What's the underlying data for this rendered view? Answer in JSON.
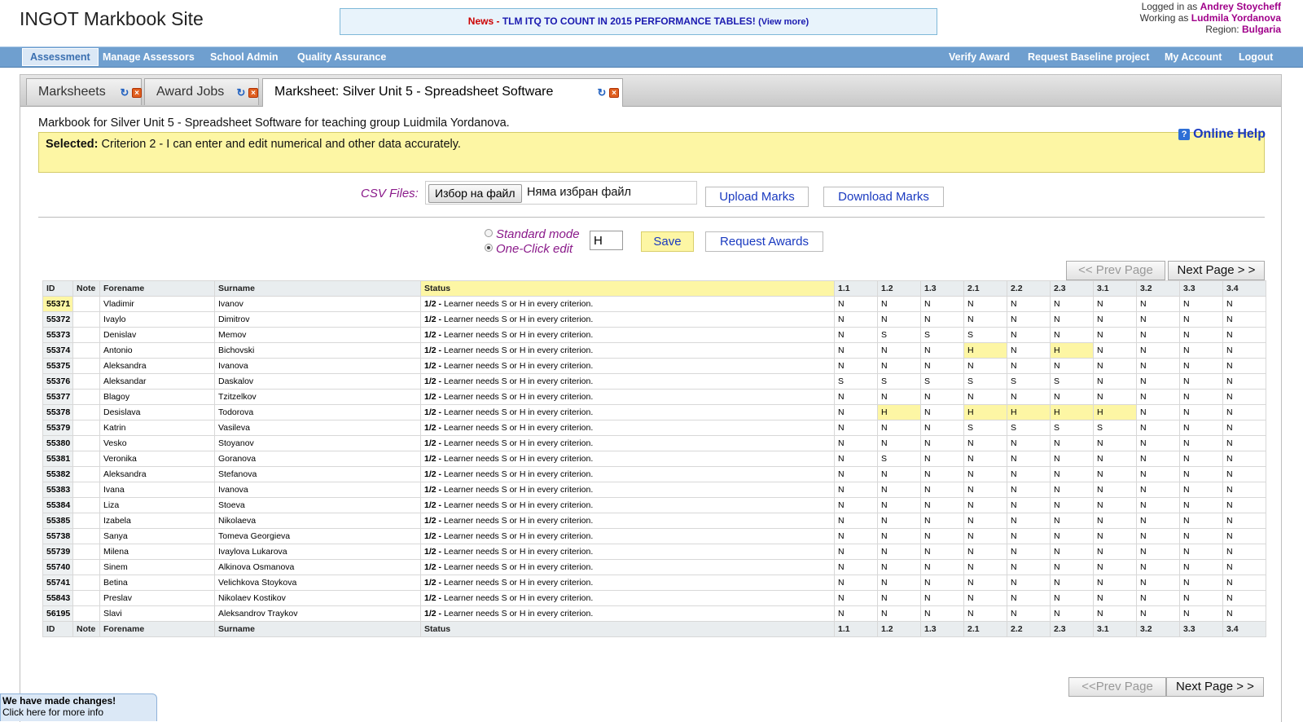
{
  "header": {
    "site_title": "INGOT Markbook Site",
    "news_label": "News",
    "news_text": "TLM ITQ TO COUNT IN 2015 PERFORMANCE TABLES!",
    "news_more": "(View more)",
    "logged_prefix": "Logged in as",
    "logged_user": "Andrey Stoycheff",
    "working_prefix": "Working as",
    "working_user": "Ludmila Yordanova",
    "region_prefix": "Region:",
    "region": "Bulgaria"
  },
  "nav": {
    "left": [
      "Assessment",
      "Manage Assessors",
      "School Admin",
      "Quality Assurance"
    ],
    "right": [
      "Verify Award",
      "Request Baseline project",
      "My Account",
      "Logout"
    ]
  },
  "tabs": [
    "Marksheets",
    "Award Jobs",
    "Marksheet: Silver Unit 5 - Spreadsheet Software"
  ],
  "markbook": {
    "description": "Markbook for Silver Unit 5 - Spreadsheet Software for teaching group Luidmila Yordanova.",
    "online_help": "Online Help",
    "selected_label": "Selected:",
    "selected_text": "Criterion 2 - I can enter and edit numerical and other data accurately."
  },
  "csv": {
    "label": "CSV Files:",
    "choose_file": "Избор на файл",
    "no_file": "Няма избран файл",
    "upload": "Upload Marks",
    "download": "Download Marks"
  },
  "modes": {
    "standard": "Standard mode",
    "one_click": "One-Click edit",
    "mark_value": "H",
    "save": "Save",
    "request_awards": "Request Awards"
  },
  "pager": {
    "prev_top": "<< Prev Page",
    "next_top": "Next Page > >",
    "prev_bottom": "<<Prev Page",
    "next_bottom": "Next Page > >"
  },
  "table": {
    "headers": [
      "ID",
      "Note",
      "Forename",
      "Surname",
      "Status"
    ],
    "criteria": [
      "1.1",
      "1.2",
      "1.3",
      "2.1",
      "2.2",
      "2.3",
      "3.1",
      "3.2",
      "3.3",
      "3.4"
    ],
    "status_code": "1/2 -",
    "status_text": "Learner needs S or H in every criterion.",
    "rows": [
      {
        "id": "55371",
        "forename": "Vladimir",
        "surname": "Ivanov",
        "marks": [
          "N",
          "N",
          "N",
          "N",
          "N",
          "N",
          "N",
          "N",
          "N",
          "N"
        ]
      },
      {
        "id": "55372",
        "forename": "Ivaylo",
        "surname": "Dimitrov",
        "marks": [
          "N",
          "N",
          "N",
          "N",
          "N",
          "N",
          "N",
          "N",
          "N",
          "N"
        ]
      },
      {
        "id": "55373",
        "forename": "Denislav",
        "surname": "Memov",
        "marks": [
          "N",
          "S",
          "S",
          "S",
          "N",
          "N",
          "N",
          "N",
          "N",
          "N"
        ]
      },
      {
        "id": "55374",
        "forename": "Antonio",
        "surname": "Bichovski",
        "marks": [
          "N",
          "N",
          "N",
          "H",
          "N",
          "H",
          "N",
          "N",
          "N",
          "N"
        ]
      },
      {
        "id": "55375",
        "forename": "Aleksandra",
        "surname": "Ivanova",
        "marks": [
          "N",
          "N",
          "N",
          "N",
          "N",
          "N",
          "N",
          "N",
          "N",
          "N"
        ]
      },
      {
        "id": "55376",
        "forename": "Aleksandar",
        "surname": "Daskalov",
        "marks": [
          "S",
          "S",
          "S",
          "S",
          "S",
          "S",
          "N",
          "N",
          "N",
          "N"
        ]
      },
      {
        "id": "55377",
        "forename": "Blagoy",
        "surname": "Tzitzelkov",
        "marks": [
          "N",
          "N",
          "N",
          "N",
          "N",
          "N",
          "N",
          "N",
          "N",
          "N"
        ]
      },
      {
        "id": "55378",
        "forename": "Desislava",
        "surname": "Todorova",
        "marks": [
          "N",
          "H",
          "N",
          "H",
          "H",
          "H",
          "H",
          "N",
          "N",
          "N"
        ]
      },
      {
        "id": "55379",
        "forename": "Katrin",
        "surname": "Vasileva",
        "marks": [
          "N",
          "N",
          "N",
          "S",
          "S",
          "S",
          "S",
          "N",
          "N",
          "N"
        ]
      },
      {
        "id": "55380",
        "forename": "Vesko",
        "surname": "Stoyanov",
        "marks": [
          "N",
          "N",
          "N",
          "N",
          "N",
          "N",
          "N",
          "N",
          "N",
          "N"
        ]
      },
      {
        "id": "55381",
        "forename": "Veronika",
        "surname": "Goranova",
        "marks": [
          "N",
          "S",
          "N",
          "N",
          "N",
          "N",
          "N",
          "N",
          "N",
          "N"
        ]
      },
      {
        "id": "55382",
        "forename": "Aleksandra",
        "surname": "Stefanova",
        "marks": [
          "N",
          "N",
          "N",
          "N",
          "N",
          "N",
          "N",
          "N",
          "N",
          "N"
        ]
      },
      {
        "id": "55383",
        "forename": "Ivana",
        "surname": "Ivanova",
        "marks": [
          "N",
          "N",
          "N",
          "N",
          "N",
          "N",
          "N",
          "N",
          "N",
          "N"
        ]
      },
      {
        "id": "55384",
        "forename": "Liza",
        "surname": "Stoeva",
        "marks": [
          "N",
          "N",
          "N",
          "N",
          "N",
          "N",
          "N",
          "N",
          "N",
          "N"
        ]
      },
      {
        "id": "55385",
        "forename": "Izabela",
        "surname": "Nikolaeva",
        "marks": [
          "N",
          "N",
          "N",
          "N",
          "N",
          "N",
          "N",
          "N",
          "N",
          "N"
        ]
      },
      {
        "id": "55738",
        "forename": "Sanya",
        "surname": "Tomeva Georgieva",
        "marks": [
          "N",
          "N",
          "N",
          "N",
          "N",
          "N",
          "N",
          "N",
          "N",
          "N"
        ]
      },
      {
        "id": "55739",
        "forename": "Milena",
        "surname": "Ivaylova Lukarova",
        "marks": [
          "N",
          "N",
          "N",
          "N",
          "N",
          "N",
          "N",
          "N",
          "N",
          "N"
        ]
      },
      {
        "id": "55740",
        "forename": "Sinem",
        "surname": "Alkinova Osmanova",
        "marks": [
          "N",
          "N",
          "N",
          "N",
          "N",
          "N",
          "N",
          "N",
          "N",
          "N"
        ]
      },
      {
        "id": "55741",
        "forename": "Betina",
        "surname": "Velichkova Stoykova",
        "marks": [
          "N",
          "N",
          "N",
          "N",
          "N",
          "N",
          "N",
          "N",
          "N",
          "N"
        ]
      },
      {
        "id": "55843",
        "forename": "Preslav",
        "surname": "Nikolaev Kostikov",
        "marks": [
          "N",
          "N",
          "N",
          "N",
          "N",
          "N",
          "N",
          "N",
          "N",
          "N"
        ]
      },
      {
        "id": "56195",
        "forename": "Slavi",
        "surname": "Aleksandrov Traykov",
        "marks": [
          "N",
          "N",
          "N",
          "N",
          "N",
          "N",
          "N",
          "N",
          "N",
          "N"
        ]
      }
    ]
  },
  "changes": {
    "title": "We have made changes!",
    "subtitle": "Click here for more info"
  },
  "colors": {
    "nav_bar": "#6f9fcf",
    "highlight_yellow": "#fdf6a4",
    "link_blue": "#1a3ac0",
    "purple_label": "#8a1a8a",
    "news_red": "#cc0000"
  }
}
